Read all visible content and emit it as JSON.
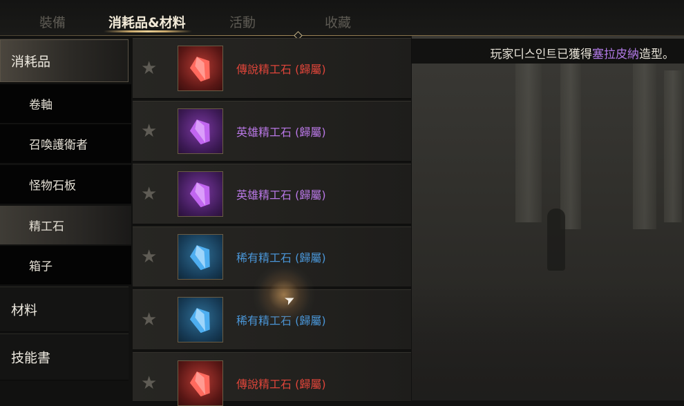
{
  "tabs": [
    "裝備",
    "消耗品&材料",
    "活動",
    "收藏"
  ],
  "active_tab": 1,
  "notification": {
    "prefix": "玩家디스인트已獲得",
    "highlight": "塞拉皮納",
    "suffix": "造型。"
  },
  "categories": {
    "consumables": "消耗品",
    "materials": "材料",
    "skill_books": "技能書"
  },
  "subcategories": [
    "卷軸",
    "召喚護衛者",
    "怪物石板",
    "精工石",
    "箱子"
  ],
  "selected_subcategory": 3,
  "items": [
    {
      "name": "傳說精工石 (歸屬)",
      "grade": "legendary"
    },
    {
      "name": "英雄精工石 (歸屬)",
      "grade": "hero"
    },
    {
      "name": "英雄精工石 (歸屬)",
      "grade": "hero"
    },
    {
      "name": "稀有精工石 (歸屬)",
      "grade": "rare"
    },
    {
      "name": "稀有精工石 (歸屬)",
      "grade": "rare"
    },
    {
      "name": "傳說精工石 (歸屬)",
      "grade": "legendary"
    }
  ],
  "colors": {
    "legendary": "#e0453a",
    "hero": "#b978e6",
    "rare": "#4a96d8",
    "highlight": "#b27ae6"
  },
  "icons": {
    "favorite": "star-icon",
    "item": "gem-icon",
    "cursor": "cursor-icon"
  }
}
